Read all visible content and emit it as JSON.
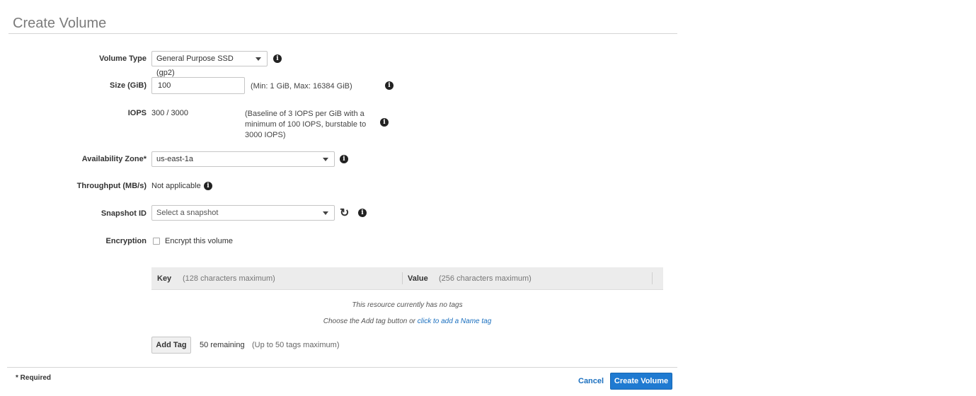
{
  "page": {
    "title": "Create Volume"
  },
  "form": {
    "volume_type": {
      "label": "Volume Type",
      "value": "General Purpose SSD (gp2)"
    },
    "size": {
      "label": "Size (GiB)",
      "value": "100",
      "hint": "(Min: 1 GiB, Max: 16384 GiB)"
    },
    "iops": {
      "label": "IOPS",
      "value": "300 / 3000",
      "hint_line1": "(Baseline of 3 IOPS per GiB with a",
      "hint_line2": "minimum of 100 IOPS, burstable to",
      "hint_line3": "3000 IOPS)"
    },
    "availability_zone": {
      "label": "Availability Zone*",
      "value": "us-east-1a"
    },
    "throughput": {
      "label": "Throughput (MB/s)",
      "value": "Not applicable"
    },
    "snapshot": {
      "label": "Snapshot ID",
      "placeholder": "Select a snapshot"
    },
    "encryption": {
      "label": "Encryption",
      "checkbox_label": "Encrypt this volume",
      "checked": false
    }
  },
  "tags": {
    "key_header": "Key",
    "key_hint": "(128 characters maximum)",
    "value_header": "Value",
    "value_hint": "(256 characters maximum)",
    "empty_message": "This resource currently has no tags",
    "help_prefix": "Choose the Add tag button or ",
    "help_link": "click to add a Name tag",
    "add_tag_label": "Add Tag",
    "remaining": "50 remaining",
    "limit_note": "(Up to 50 tags maximum)"
  },
  "footer": {
    "required_note": "* Required",
    "cancel_label": "Cancel",
    "submit_label": "Create Volume"
  },
  "icons": {
    "info": "info-icon",
    "refresh": "refresh-icon",
    "caret": "chevron-down-icon"
  },
  "colors": {
    "primary": "#1f7ad1",
    "link": "#1a6fbf"
  }
}
